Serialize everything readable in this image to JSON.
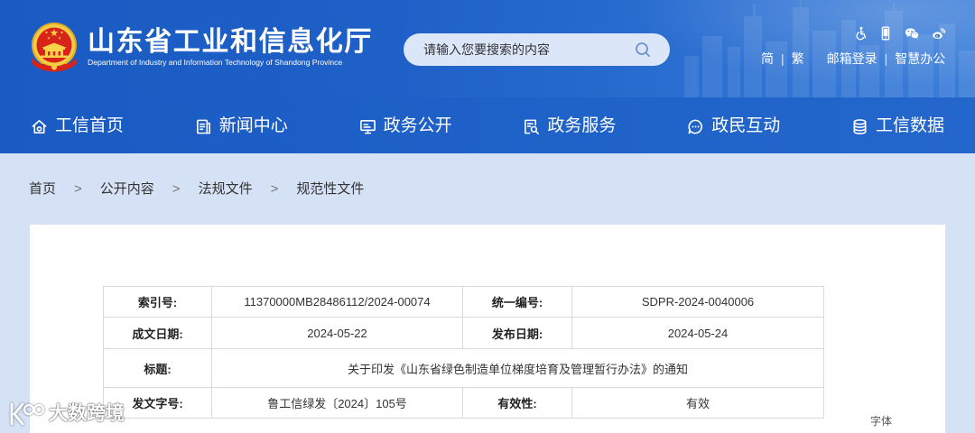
{
  "colors": {
    "header_blue": "#1e60c7",
    "page_background": "#d5e1f4",
    "panel_background": "#ffffff",
    "text_primary": "#333333",
    "table_border": "#d9d9d9",
    "emblem_gold": "#f4cd44",
    "emblem_red": "#d8231b"
  },
  "header": {
    "site_title": "山东省工业和信息化厅",
    "site_subtitle": "Department of Industry and Information Technology of Shandong Province",
    "search_placeholder": "请输入您要搜索的内容",
    "top_icons": [
      "accessibility-icon",
      "mobile-icon",
      "wechat-icon",
      "weibo-icon"
    ],
    "links": {
      "simplified": "简",
      "traditional": "繁",
      "mail_login": "邮箱登录",
      "smart_office": "智慧办公",
      "separator": "|"
    }
  },
  "nav": {
    "items": [
      {
        "label": "工信首页",
        "icon": "home-icon"
      },
      {
        "label": "新闻中心",
        "icon": "news-document-icon"
      },
      {
        "label": "政务公开",
        "icon": "monitor-icon"
      },
      {
        "label": "政务服务",
        "icon": "search-document-icon"
      },
      {
        "label": "政民互动",
        "icon": "chat-icon"
      },
      {
        "label": "工信数据",
        "icon": "database-icon"
      }
    ]
  },
  "breadcrumb": {
    "separator": ">",
    "items": [
      "首页",
      "公开内容",
      "法规文件",
      "规范性文件"
    ]
  },
  "document_info": {
    "index_number": {
      "label": "索引号:",
      "value": "11370000MB28486112/2024-00074"
    },
    "unified_number": {
      "label": "统一编号:",
      "value": "SDPR-2024-0040006"
    },
    "written_date": {
      "label": "成文日期:",
      "value": "2024-05-22"
    },
    "publish_date": {
      "label": "发布日期:",
      "value": "2024-05-24"
    },
    "title": {
      "label": "标题:",
      "value": "关于印发《山东省绿色制造单位梯度培育及管理暂行办法》的通知"
    },
    "document_number": {
      "label": "发文字号:",
      "value": "鲁工信绿发〔2024〕105号"
    },
    "validity": {
      "label": "有效性:",
      "value": "有效"
    }
  },
  "font_size_label": "字体",
  "watermark": "大数跨境"
}
